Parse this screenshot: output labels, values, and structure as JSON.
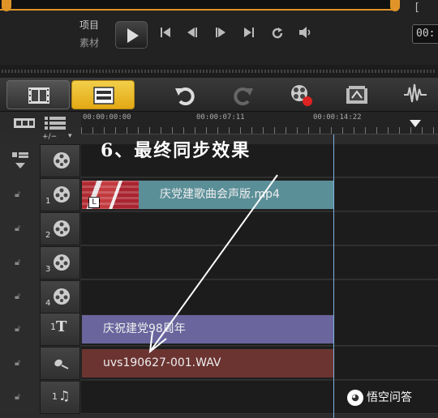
{
  "player": {
    "mode_project": "项目",
    "mode_clip": "素材",
    "timecode": "00:",
    "bracket": "["
  },
  "toolbar": {
    "views": [
      "storyboard",
      "timeline"
    ],
    "active_view": "timeline",
    "tools": [
      "undo-icon",
      "redo-icon",
      "record-capture-icon",
      "auto-music-icon",
      "sound-mixer-icon"
    ]
  },
  "ruler": {
    "labels": [
      "00:00:00:00",
      "00:00:07:11",
      "00:00:14:22"
    ]
  },
  "tracks_panel": {
    "zoom_label": "+/−",
    "annotation": "6、最终同步效果",
    "tracks": [
      {
        "name": "video-main",
        "num": "",
        "clip": ""
      },
      {
        "name": "overlay-1",
        "num": "1",
        "clip": "庆党建歌曲会声版.mp4"
      },
      {
        "name": "overlay-2",
        "num": "2",
        "clip": ""
      },
      {
        "name": "overlay-3",
        "num": "3",
        "clip": ""
      },
      {
        "name": "overlay-4",
        "num": "4",
        "clip": ""
      },
      {
        "name": "title-1",
        "num": "1",
        "clip": "庆祝建党98周年"
      },
      {
        "name": "voice",
        "num": "",
        "clip": "uvs190627-001.WAV"
      },
      {
        "name": "music-1",
        "num": "1",
        "clip": ""
      }
    ]
  },
  "watermark": {
    "text": "悟空问答"
  },
  "colors": {
    "accent_orange": "#e09428",
    "timeline_button": "#e3a814",
    "video_clip": "#5b8f98",
    "title_clip": "#6a659d",
    "audio_clip": "#6b3431",
    "playhead_line": "#7fb2e0"
  }
}
